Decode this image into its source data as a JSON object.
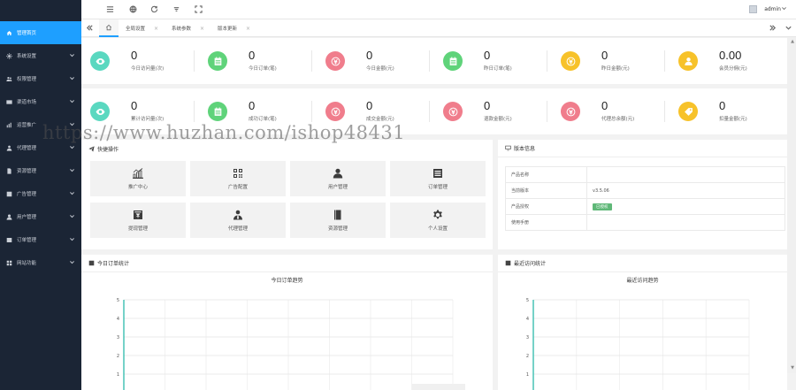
{
  "sidebar": {
    "items": [
      {
        "label": "管理首页",
        "icon": "home-icon",
        "active": true
      },
      {
        "label": "系统设置",
        "icon": "gear-icon"
      },
      {
        "label": "权限管理",
        "icon": "user-group-icon"
      },
      {
        "label": "渠道市场",
        "icon": "card-icon"
      },
      {
        "label": "运营推广",
        "icon": "chart-icon"
      },
      {
        "label": "代理管理",
        "icon": "agent-icon"
      },
      {
        "label": "资源管理",
        "icon": "file-icon"
      },
      {
        "label": "广告管理",
        "icon": "ad-icon"
      },
      {
        "label": "用户管理",
        "icon": "person-icon"
      },
      {
        "label": "订单管理",
        "icon": "order-icon"
      },
      {
        "label": "网站功能",
        "icon": "grid-icon"
      }
    ]
  },
  "header": {
    "user": "admin"
  },
  "tabs": [
    {
      "label": "全局设置"
    },
    {
      "label": "系统参数"
    },
    {
      "label": "版本更新"
    }
  ],
  "stats_row1": [
    {
      "value": "0",
      "label": "今日访问量(次)",
      "color": "#5ad8c0",
      "icon": "eye-icon"
    },
    {
      "value": "0",
      "label": "今日订单(笔)",
      "color": "#5fd37a",
      "icon": "calendar-icon"
    },
    {
      "value": "0",
      "label": "今日金额(元)",
      "color": "#f07d8c",
      "icon": "money-icon"
    },
    {
      "value": "0",
      "label": "昨日订单(笔)",
      "color": "#5fd37a",
      "icon": "calendar-icon"
    },
    {
      "value": "0",
      "label": "昨日金额(元)",
      "color": "#f7c22a",
      "icon": "money-icon"
    },
    {
      "value": "0.00",
      "label": "会员分佣(元)",
      "color": "#f7c22a",
      "icon": "user-icon"
    }
  ],
  "stats_row2": [
    {
      "value": "0",
      "label": "累计访问量(次)",
      "color": "#5ad8c0",
      "icon": "eye-icon"
    },
    {
      "value": "0",
      "label": "成功订单(笔)",
      "color": "#5fd37a",
      "icon": "calendar-icon"
    },
    {
      "value": "0",
      "label": "成交金额(元)",
      "color": "#f07d8c",
      "icon": "money-icon"
    },
    {
      "value": "0",
      "label": "退款金额(元)",
      "color": "#f07d8c",
      "icon": "money-icon"
    },
    {
      "value": "0",
      "label": "代理总余额(元)",
      "color": "#f07d8c",
      "icon": "money-icon"
    },
    {
      "value": "0",
      "label": "扣量金额(元)",
      "color": "#f7c22a",
      "icon": "tag-icon"
    }
  ],
  "quick": {
    "title": "快捷操作",
    "buttons": [
      {
        "label": "推广中心",
        "icon": "chart-bars-icon"
      },
      {
        "label": "广告配置",
        "icon": "qr-icon"
      },
      {
        "label": "用户管理",
        "icon": "person-icon"
      },
      {
        "label": "订单管理",
        "icon": "order-list-icon"
      },
      {
        "label": "提现管理",
        "icon": "withdraw-icon"
      },
      {
        "label": "代理管理",
        "icon": "agent-icon"
      },
      {
        "label": "资源管理",
        "icon": "book-icon"
      },
      {
        "label": "个人设置",
        "icon": "gear-icon"
      }
    ]
  },
  "version": {
    "title": "版本信息",
    "rows": [
      {
        "key": "产品名称",
        "value": ""
      },
      {
        "key": "当前版本",
        "value": "v3.5.06"
      },
      {
        "key": "产品授权",
        "value": "已授权",
        "badge": true
      },
      {
        "key": "使用手册",
        "value": ""
      }
    ]
  },
  "order_panel": {
    "title": "今日订单统计",
    "chart_title": "今日订单趋势"
  },
  "visit_panel": {
    "title": "最近访问统计",
    "chart_title": "最近访问趋势"
  },
  "chart_data": [
    {
      "type": "line",
      "title": "今日订单趋势",
      "ylim": [
        0,
        5
      ],
      "yticks": [
        1,
        2,
        3,
        4,
        5
      ],
      "series": [],
      "grid": true,
      "axis_color": "#3bbfb0"
    },
    {
      "type": "line",
      "title": "最近访问趋势",
      "ylim": [
        0,
        5
      ],
      "yticks": [
        1,
        2,
        3,
        4,
        5
      ],
      "series": [],
      "grid": true,
      "axis_color": "#3bbfb0"
    }
  ],
  "watermark": "https://www.huzhan.com/ishop48431"
}
